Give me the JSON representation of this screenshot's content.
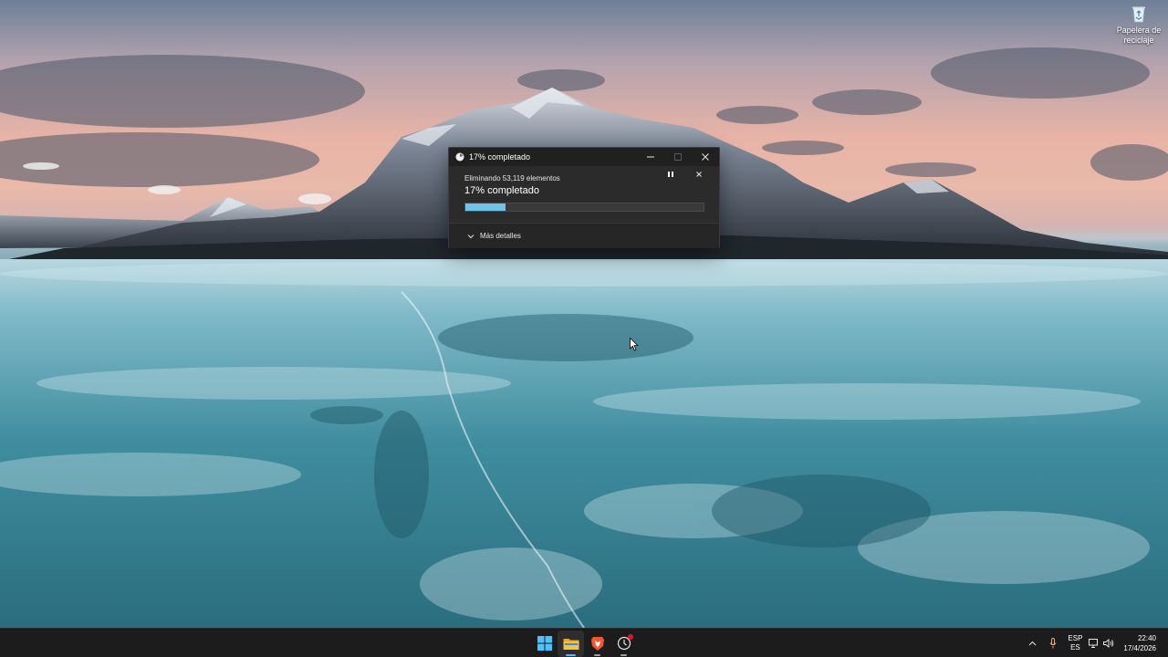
{
  "desktop": {
    "recycle_bin_label": "Papelera de reciclaje"
  },
  "dialog": {
    "title": "17% completado",
    "status": "Eliminando 53,119 elementos",
    "percent_text": "17% completado",
    "progress": 0.17,
    "more_details": "Más detalles",
    "accent_color": "#6ec3ea"
  },
  "taskbar": {
    "apps": [
      {
        "name": "start",
        "icon": "windows-logo-icon"
      },
      {
        "name": "file-explorer",
        "icon": "folder-icon",
        "active": true
      },
      {
        "name": "brave",
        "icon": "brave-lion-icon"
      },
      {
        "name": "app-4",
        "icon": "clock-icon",
        "badge": true
      }
    ],
    "tray": {
      "lang_top": "ESP",
      "lang_bottom": "ES",
      "time": "22:40",
      "date": "17/4/2026"
    }
  }
}
